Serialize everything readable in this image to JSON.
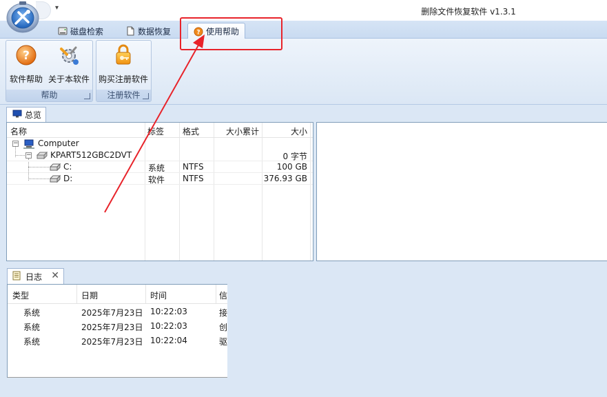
{
  "window": {
    "title": "删除文件恢复软件 v1.3.1",
    "qat_arrow": "▾"
  },
  "ribbon_tabs": [
    {
      "label": "磁盘检索"
    },
    {
      "label": "数据恢复"
    },
    {
      "label": "使用帮助",
      "active": true
    }
  ],
  "ribbon": {
    "help_group": {
      "title": "帮助",
      "buttons": [
        {
          "label": "软件帮助"
        },
        {
          "label": "关于本软件"
        }
      ]
    },
    "register_group": {
      "title": "注册软件",
      "buttons": [
        {
          "label": "购买注册软件"
        }
      ]
    }
  },
  "overview": {
    "tab_label": "总览",
    "columns": [
      "名称",
      "标签",
      "格式",
      "大小累计",
      "大小"
    ],
    "rows": [
      {
        "name": "Computer",
        "label": "",
        "format": "",
        "total": "",
        "size": ""
      },
      {
        "name": "KPART512GBC2DVT",
        "label": "",
        "format": "",
        "total": "",
        "size": "0 字节"
      },
      {
        "name": "C:",
        "label": "系统",
        "format": "NTFS",
        "total": "",
        "size": "100 GB"
      },
      {
        "name": "D:",
        "label": "软件",
        "format": "NTFS",
        "total": "",
        "size": "376.93 GB"
      }
    ]
  },
  "log": {
    "tab_label": "日志",
    "close_glyph": "✕",
    "columns": [
      "类型",
      "日期",
      "时间",
      "信"
    ],
    "rows": [
      {
        "type": "系统",
        "date": "2025年7月23日",
        "time": "10:22:03",
        "info": "接"
      },
      {
        "type": "系统",
        "date": "2025年7月23日",
        "time": "10:22:03",
        "info": "创"
      },
      {
        "type": "系统",
        "date": "2025年7月23日",
        "time": "10:22:04",
        "info": "驱"
      }
    ]
  },
  "colors": {
    "highlight": "#e8232a",
    "ribbon_bg": "#dbe7f5",
    "panel_border": "#7f9db9"
  },
  "icons": {
    "app": "app-orb-icon",
    "disk_search_tab": "disk-icon",
    "data_recovery_tab": "document-icon",
    "help_tab": "help-question-icon",
    "help_button": "help-question-icon",
    "about_button": "gear-tools-icon",
    "register_button": "lock-key-icon",
    "overview_tab": "monitor-icon",
    "computer_node": "computer-icon",
    "disk_node": "harddisk-icon",
    "partition_node": "drive-icon",
    "log_tab": "notepad-icon"
  }
}
